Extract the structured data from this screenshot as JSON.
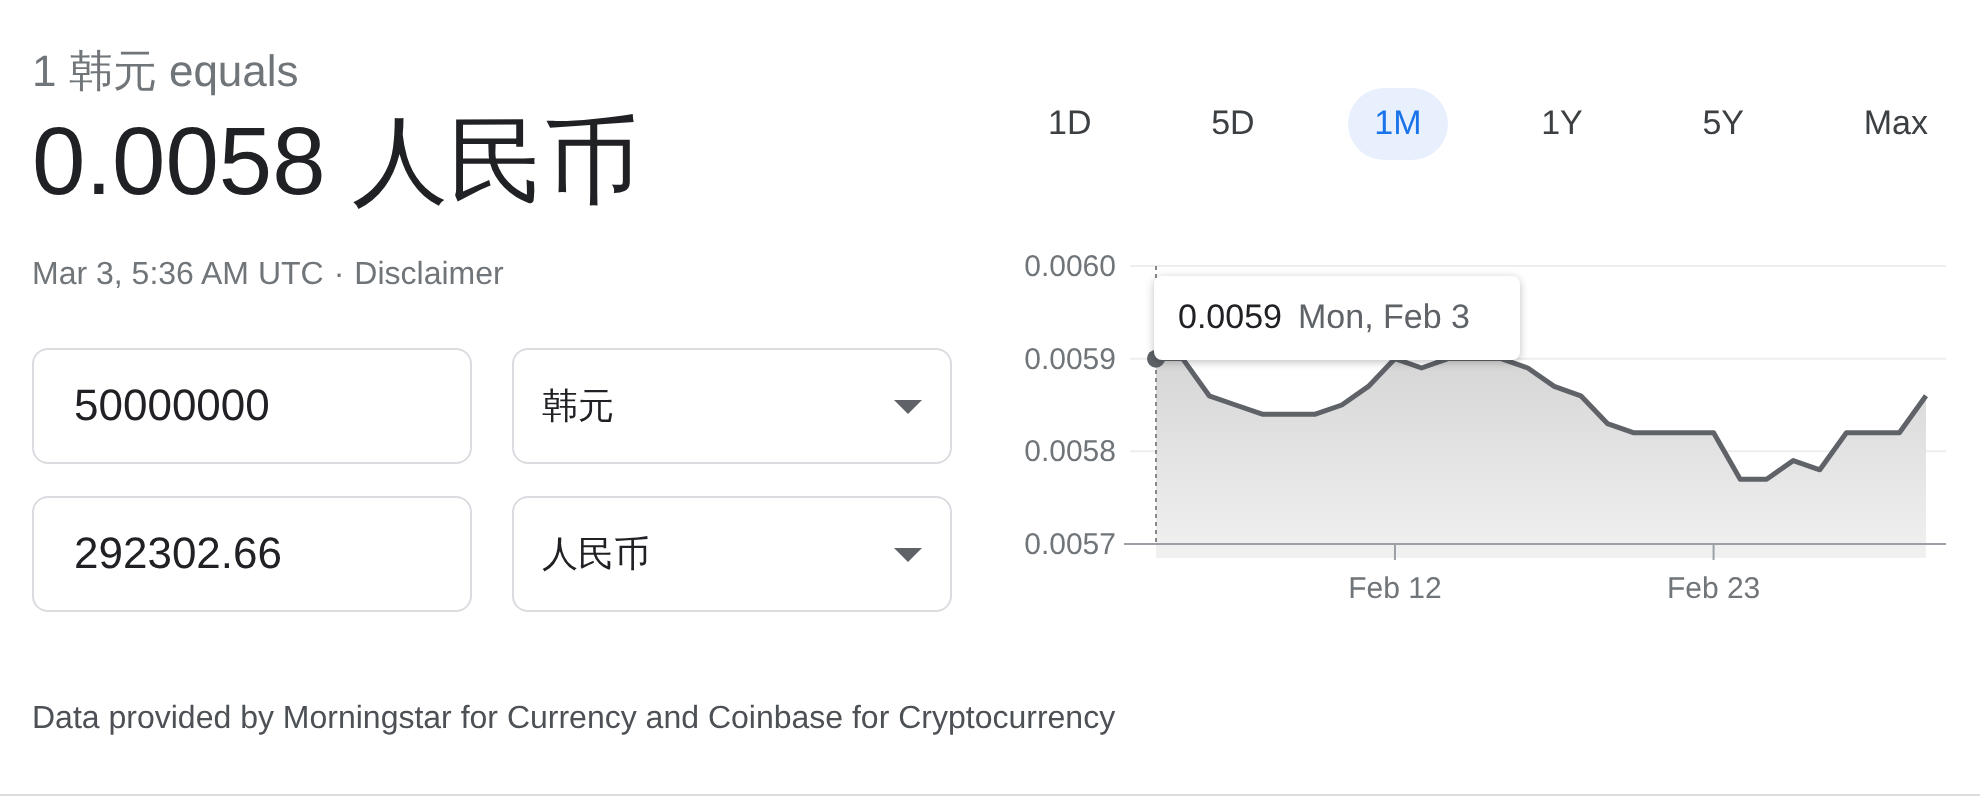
{
  "header": {
    "base": "1 韩元 equals",
    "rate": "0.0058 人民币",
    "timestamp": "Mar 3, 5:36 AM UTC",
    "separator": "·",
    "disclaimer": "Disclaimer"
  },
  "converter": [
    {
      "amount": "50000000",
      "currency": "韩元"
    },
    {
      "amount": "292302.66",
      "currency": "人民币"
    }
  ],
  "ranges": [
    {
      "label": "1D",
      "selected": false
    },
    {
      "label": "5D",
      "selected": false
    },
    {
      "label": "1M",
      "selected": true
    },
    {
      "label": "1Y",
      "selected": false
    },
    {
      "label": "5Y",
      "selected": false
    },
    {
      "label": "Max",
      "selected": false
    }
  ],
  "chart": {
    "tooltip": {
      "value": "0.0059",
      "date": "Mon, Feb 3"
    },
    "chart_data": {
      "type": "area",
      "categories": [
        null,
        null,
        null,
        null,
        null,
        null,
        null,
        null,
        null,
        "Feb 12",
        null,
        null,
        null,
        null,
        null,
        null,
        null,
        null,
        null,
        null,
        null,
        "Feb 23",
        null,
        null,
        null,
        null,
        null,
        null,
        null,
        null
      ],
      "series": [
        {
          "color": "#5f6368",
          "values": [
            0.0059,
            0.0059,
            0.00586,
            0.00585,
            0.00584,
            0.00584,
            0.00584,
            0.00585,
            0.00587,
            0.0059,
            0.00589,
            0.0059,
            0.0059,
            0.0059,
            0.00589,
            0.00587,
            0.00586,
            0.00583,
            0.00582,
            0.00582,
            0.00582,
            0.00582,
            0.00577,
            0.00577,
            0.00579,
            0.00578,
            0.00582,
            0.00582,
            0.00582,
            0.00586
          ]
        }
      ],
      "ylim": [
        0.0057,
        0.006
      ],
      "yticks": [
        {
          "value": 0.006,
          "label": "0.0060"
        },
        {
          "value": 0.0059,
          "label": "0.0059"
        },
        {
          "value": 0.0058,
          "label": "0.0058"
        },
        {
          "value": 0.0057,
          "label": "0.0057"
        }
      ]
    }
  },
  "footer": "Data provided by Morningstar for Currency and Coinbase for Cryptocurrency"
}
